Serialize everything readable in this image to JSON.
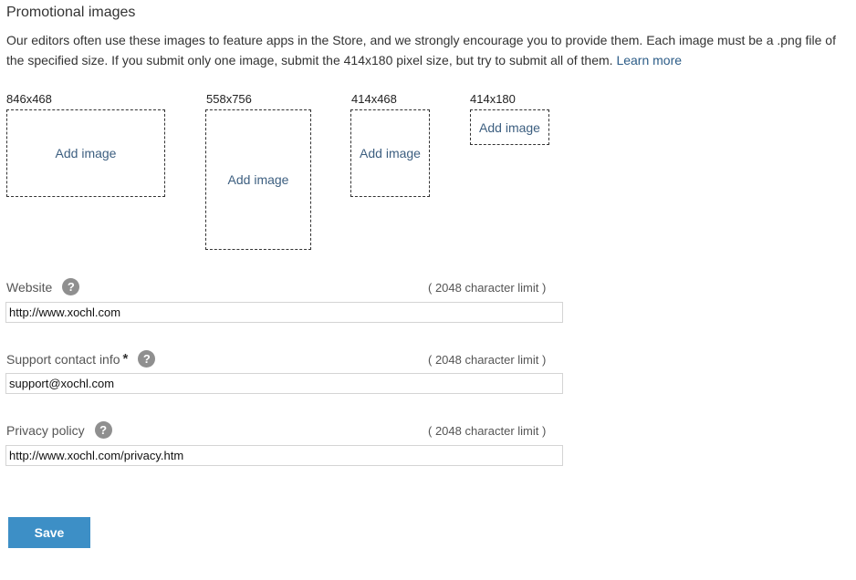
{
  "section": {
    "title": "Promotional images",
    "description": "Our editors often use these images to feature apps in the Store, and we strongly encourage you to provide them. Each image must be a .png file of the specified size. If you submit only one image, submit the 414x180 pixel size, but try to submit all of them.",
    "learn_more": "Learn more"
  },
  "images": [
    {
      "size": "846x468",
      "action": "Add image"
    },
    {
      "size": "558x756",
      "action": "Add image"
    },
    {
      "size": "414x468",
      "action": "Add image"
    },
    {
      "size": "414x180",
      "action": "Add image"
    }
  ],
  "fields": {
    "website": {
      "label": "Website",
      "limit": "( 2048 character limit )",
      "value": "http://www.xochl.com"
    },
    "support": {
      "label": "Support contact info",
      "required_mark": "*",
      "limit": "( 2048 character limit )",
      "value": "support@xochl.com"
    },
    "privacy": {
      "label": "Privacy policy",
      "limit": "( 2048 character limit )",
      "value": "http://www.xochl.com/privacy.htm"
    }
  },
  "help_icon_glyph": "?",
  "save_label": "Save",
  "colors": {
    "accent": "#3d8fc6",
    "link": "#2c5c87",
    "help": "#8f8f8f"
  }
}
